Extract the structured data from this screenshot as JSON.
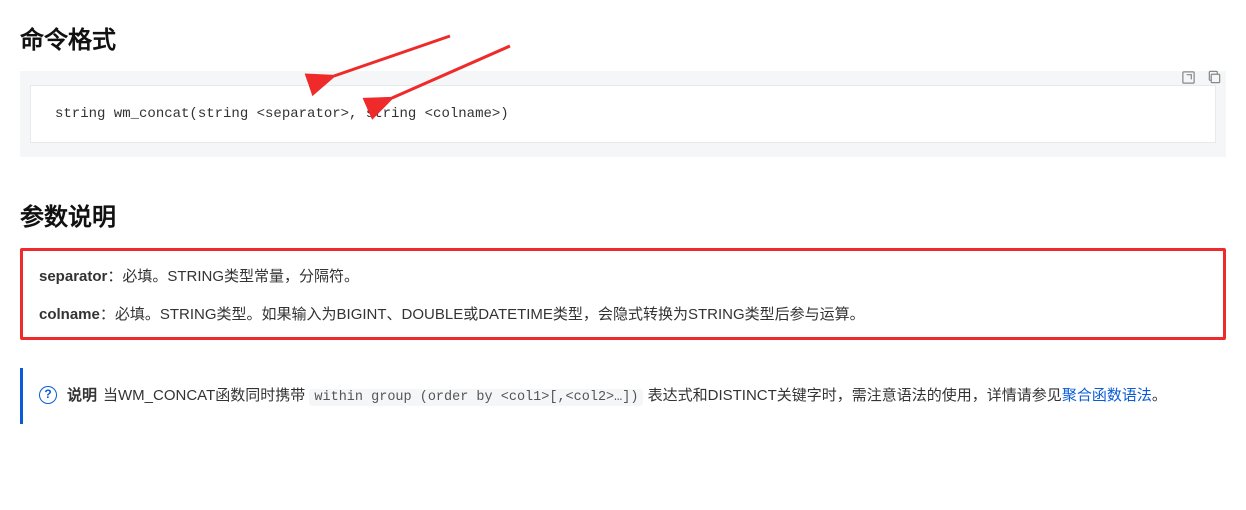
{
  "sections": {
    "syntax": {
      "heading": "命令格式",
      "code": "string wm_concat(string <separator>, string <colname>)"
    },
    "params": {
      "heading": "参数说明",
      "items": [
        {
          "name": "separator",
          "desc": "：必填。STRING类型常量，分隔符。"
        },
        {
          "name": "colname",
          "desc": "：必填。STRING类型。如果输入为BIGINT、DOUBLE或DATETIME类型，会隐式转换为STRING类型后参与运算。"
        }
      ]
    },
    "note": {
      "label": "说明",
      "text_before": "当WM_CONCAT函数同时携带 ",
      "code": "within group (order by <col1>[,<col2>…])",
      "text_after": " 表达式和DISTINCT关键字时，需注意语法的使用，详情请参见",
      "link_text": "聚合函数语法",
      "text_end": "。"
    }
  }
}
